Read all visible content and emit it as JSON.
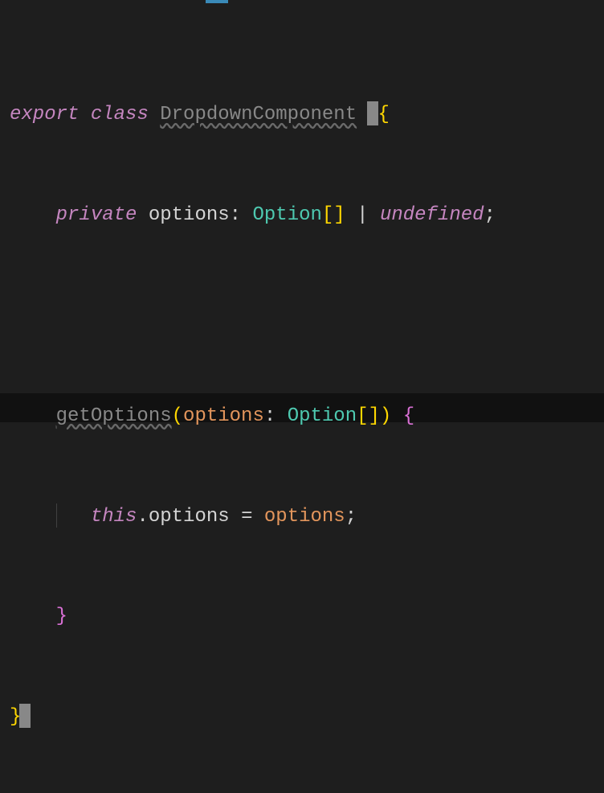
{
  "code": {
    "line1": {
      "export": "export",
      "class": "class",
      "classname": "DropdownComponent",
      "lbrace": "{"
    },
    "line2": {
      "private": "private",
      "prop": "options",
      "colon": ":",
      "type": "Option",
      "brackets": "[]",
      "pipe": "|",
      "undefined": "undefined",
      "semi": ";"
    },
    "line3": {
      "method": "getOptions",
      "lparen": "(",
      "param": "options",
      "colon": ":",
      "type": "Option",
      "brackets": "[]",
      "rparen": ")",
      "lbrace": "{"
    },
    "line4": {
      "this": "this",
      "dot": ".",
      "prop": "options",
      "eq": "=",
      "param": "options",
      "semi": ";"
    },
    "line5": {
      "rbrace": "}"
    },
    "line6": {
      "rbrace": "}"
    }
  },
  "colors": {
    "background": "#1e1e1e",
    "keyword": "#c586c0",
    "type": "#4ec9b0",
    "param": "#e2955c",
    "brace": "#ffd700",
    "text": "#d4d4d4",
    "muted": "#888888"
  }
}
